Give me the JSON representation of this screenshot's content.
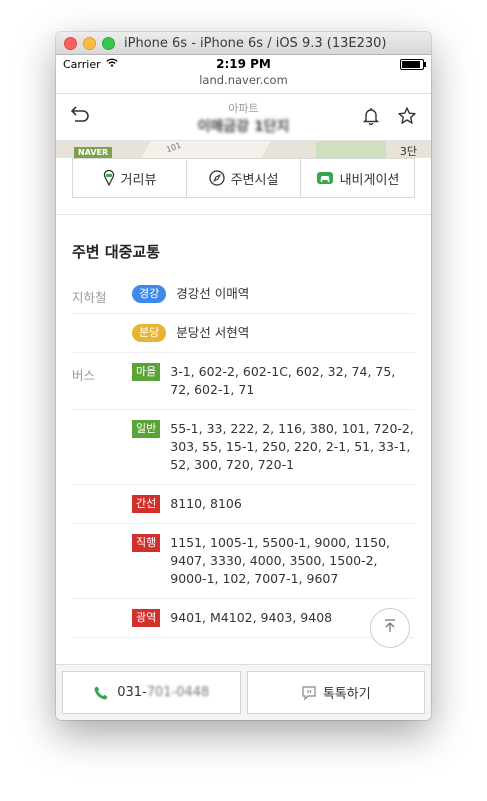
{
  "window": {
    "title": "iPhone 6s - iPhone 6s / iOS 9.3 (13E230)"
  },
  "status": {
    "carrier": "Carrier",
    "time": "2:19 PM"
  },
  "url": "land.naver.com",
  "header": {
    "subtitle": "아파트",
    "title": "이매금강 1단지"
  },
  "map": {
    "logo": "NAVER",
    "road_label": "101",
    "floor": "3단"
  },
  "toolbar": {
    "street": "거리뷰",
    "nearby": "주변시설",
    "navigation": "내비게이션"
  },
  "section": {
    "title": "주변 대중교통"
  },
  "transit": {
    "subway_label": "지하철",
    "bus_label": "버스",
    "subway": [
      {
        "badge": "경강",
        "color": "#3e8ae8",
        "text": "경강선 이매역"
      },
      {
        "badge": "분당",
        "color": "#e8b432",
        "text": "분당선 서현역"
      }
    ],
    "bus": [
      {
        "badge": "마을",
        "color": "#5aa337",
        "text": "3-1, 602-2, 602-1C, 602, 32, 74, 75, 72, 602-1, 71"
      },
      {
        "badge": "일반",
        "color": "#5aa337",
        "text": "55-1, 33, 222, 2, 116, 380, 101, 720-2, 303, 55, 15-1, 250, 220, 2-1, 51, 33-1, 52, 300, 720, 720-1"
      },
      {
        "badge": "간선",
        "color": "#d0312d",
        "text": "8110, 8106"
      },
      {
        "badge": "직행",
        "color": "#d0312d",
        "text": "1151, 1005-1, 5500-1, 9000, 1150, 9407, 3330, 4000, 3500, 1500-2, 9000-1, 102, 7007-1, 9607"
      },
      {
        "badge": "광역",
        "color": "#d0312d",
        "text": "9401, M4102, 9403, 9408"
      }
    ]
  },
  "bottom": {
    "phone_prefix": "031-",
    "phone_hidden": "701-0448",
    "talk": "톡톡하기"
  }
}
